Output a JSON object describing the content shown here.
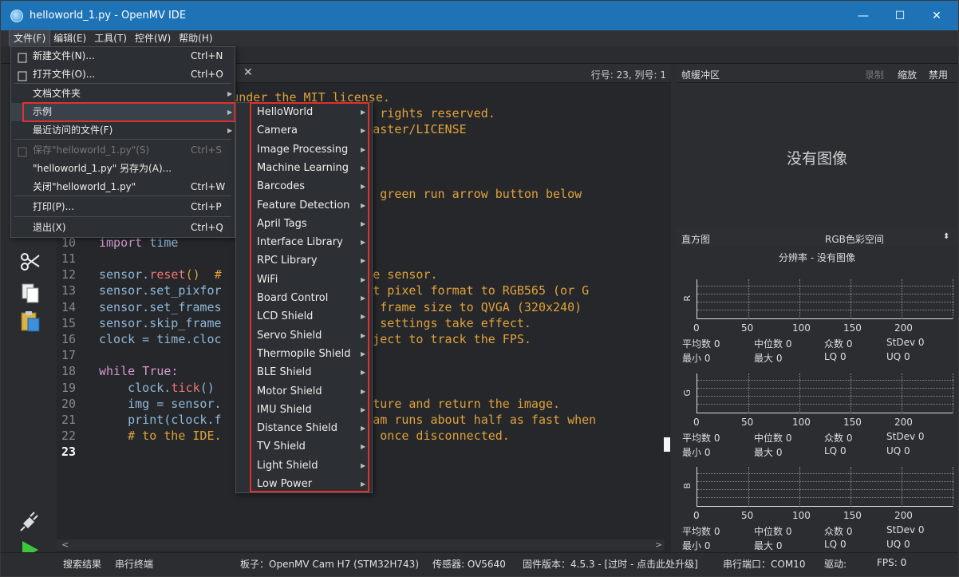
{
  "window": {
    "title": "helloworld_1.py - OpenMV IDE",
    "minimize": "—",
    "maximize": "☐",
    "close": "✕"
  },
  "menubar": {
    "items": [
      "文件(F)",
      "编辑(E)",
      "工具(T)",
      "控件(W)",
      "帮助(H)"
    ]
  },
  "editor": {
    "tab_close": "✕",
    "cursor_pos": "行号: 23, 列号: 1",
    "lines": [
      {
        "n": "",
        "segments": [
          {
            "t": "censed under the MIT license.",
            "c": "cm",
            "x": 226
          }
        ]
      },
      {
        "n": "",
        "segments": [
          {
            "t": "LLC. All rights reserved.",
            "c": "cm",
            "x": 394
          }
        ]
      },
      {
        "n": "",
        "segments": [
          {
            "t": "y/blob/master/LICENSE",
            "c": "cm",
            "x": 394
          }
        ]
      },
      {
        "n": "",
        "segments": []
      },
      {
        "n": "",
        "segments": []
      },
      {
        "n": "",
        "segments": []
      },
      {
        "n": "",
        "segments": [
          {
            "t": "k on the green run arrow button below",
            "c": "cm",
            "x": 394
          }
        ]
      },
      {
        "n": "",
        "segments": []
      },
      {
        "n": "",
        "segments": []
      },
      {
        "n": "10",
        "segments": [
          {
            "t": "import ",
            "c": "kw"
          },
          {
            "t": "time",
            "c": "id"
          }
        ]
      },
      {
        "n": "11",
        "segments": []
      },
      {
        "n": "12",
        "segments": [
          {
            "t": "sensor.",
            "c": "id"
          },
          {
            "t": "reset",
            "c": "fn"
          },
          {
            "t": "()  #",
            "c": "cm"
          },
          {
            "t": "alize the sensor.",
            "c": "cm",
            "x": 394
          }
        ]
      },
      {
        "n": "13",
        "segments": [
          {
            "t": "sensor.set_pixfor",
            "c": "id"
          },
          {
            "t": "5)  # Set pixel format to RGB565 (or G",
            "c": "cm",
            "x": 394
          }
        ]
      },
      {
        "n": "14",
        "segments": [
          {
            "t": "sensor.set_frames",
            "c": "id"
          },
          {
            "t": "   # Set frame size to QVGA (320x240)",
            "c": "cm",
            "x": 394
          }
        ]
      },
      {
        "n": "15",
        "segments": [
          {
            "t": "sensor.skip_frame",
            "c": "id"
          },
          {
            "t": "Wait for settings take effect.",
            "c": "cm",
            "x": 394
          }
        ]
      },
      {
        "n": "16",
        "segments": [
          {
            "t": "clock = time.cloc",
            "c": "id"
          },
          {
            "t": "clock object to track the FPS.",
            "c": "cm",
            "x": 394
          }
        ]
      },
      {
        "n": "17",
        "segments": []
      },
      {
        "n": "18",
        "segments": [
          {
            "t": "while ",
            "c": "kw"
          },
          {
            "t": "True:",
            "c": "kw"
          }
        ]
      },
      {
        "n": "19",
        "segments": [
          {
            "t": "    clock.",
            "c": "id"
          },
          {
            "t": "tick",
            "c": "fn"
          },
          {
            "t": "()",
            "c": "id"
          },
          {
            "t": "s clock.",
            "c": "cm",
            "x": 394
          }
        ]
      },
      {
        "n": "20",
        "segments": [
          {
            "t": "    img = sensor.",
            "c": "id"
          },
          {
            "t": "ke a picture and return the image.",
            "c": "cm",
            "x": 394
          }
        ]
      },
      {
        "n": "21",
        "segments": [
          {
            "t": "    print(clock.f",
            "c": "id"
          },
          {
            "t": "OpenMV Cam runs about half as fast when",
            "c": "cm",
            "x": 394
          }
        ]
      },
      {
        "n": "22",
        "segments": [
          {
            "t": "    # to the IDE.",
            "c": "cm"
          },
          {
            "t": "increase once disconnected.",
            "c": "cm",
            "x": 394
          }
        ]
      },
      {
        "n": "23",
        "segments": []
      }
    ]
  },
  "right_panel": {
    "frame_buffer_label": "帧缓冲区",
    "record": "录制",
    "zoom": "缩放",
    "disable": "禁用",
    "no_image": "没有图像",
    "histogram_label": "直方图",
    "color_space": "RGB色彩空间",
    "resolution": "分辨率 - 没有图像",
    "x_ticks": [
      "0",
      "50",
      "100",
      "150",
      "200"
    ],
    "channels": [
      {
        "name": "R",
        "mean": "平均数 0",
        "median": "中位数 0",
        "mode": "众数 0",
        "stdev": "StDev 0",
        "min": "最小   0",
        "max": "最大   0",
        "lq": "LQ  0",
        "uq": "UQ   0"
      },
      {
        "name": "G",
        "mean": "平均数 0",
        "median": "中位数 0",
        "mode": "众数 0",
        "stdev": "StDev 0",
        "min": "最小   0",
        "max": "最大   0",
        "lq": "LQ  0",
        "uq": "UQ   0"
      },
      {
        "name": "B",
        "mean": "平均数 0",
        "median": "中位数 0",
        "mode": "众数 0",
        "stdev": "StDev 0",
        "min": "最小   0",
        "max": "最大   0",
        "lq": "LQ  0",
        "uq": "UQ   0"
      }
    ]
  },
  "statusbar": {
    "search_results": "搜索结果",
    "serial_terminal": "串行终端",
    "board": "板子：OpenMV Cam H7 (STM32H743)",
    "sensor": "传感器: OV5640",
    "firmware": "固件版本：4.5.3 - [过时 - 点击此处升级]",
    "serial_port": "串行端口：COM10",
    "driver": "驱动:",
    "fps": "FPS: 0"
  },
  "file_menu": {
    "items": [
      {
        "label": "新建文件(N)...",
        "shortcut": "Ctrl+N",
        "icon": "new-file-icon"
      },
      {
        "label": "打开文件(O)...",
        "shortcut": "Ctrl+O",
        "icon": "open-folder-icon"
      },
      {
        "label": "文档文件夹",
        "shortcut": "",
        "submenu": true
      },
      {
        "label": "示例",
        "shortcut": "",
        "submenu": true,
        "selected": true
      },
      {
        "label": "最近访问的文件(F)",
        "shortcut": "",
        "submenu": true
      },
      {
        "label": "保存\"helloworld_1.py\"(S)",
        "shortcut": "Ctrl+S",
        "disabled": true,
        "icon": "save-icon"
      },
      {
        "label": "\"helloworld_1.py\" 另存为(A)...",
        "shortcut": ""
      },
      {
        "label": "关闭\"helloworld_1.py\"",
        "shortcut": "Ctrl+W"
      },
      {
        "label": "打印(P)...",
        "shortcut": "Ctrl+P"
      },
      {
        "label": "退出(X)",
        "shortcut": "Ctrl+Q"
      }
    ]
  },
  "examples_menu": {
    "items": [
      "HelloWorld",
      "Camera",
      "Image Processing",
      "Machine Learning",
      "Barcodes",
      "Feature Detection",
      "April Tags",
      "Interface Library",
      "RPC Library",
      "WiFi",
      "Board Control",
      "LCD Shield",
      "Servo Shield",
      "Thermopile Shield",
      "BLE Shield",
      "Motor Shield",
      "IMU Shield",
      "Distance Shield",
      "TV Shield",
      "Light Shield",
      "Low Power"
    ]
  },
  "colors": {
    "titlebar": "#1e73b7",
    "highlight_box": "#e0312f",
    "comment": "#e0a23a",
    "keyword": "#d79ad1"
  }
}
